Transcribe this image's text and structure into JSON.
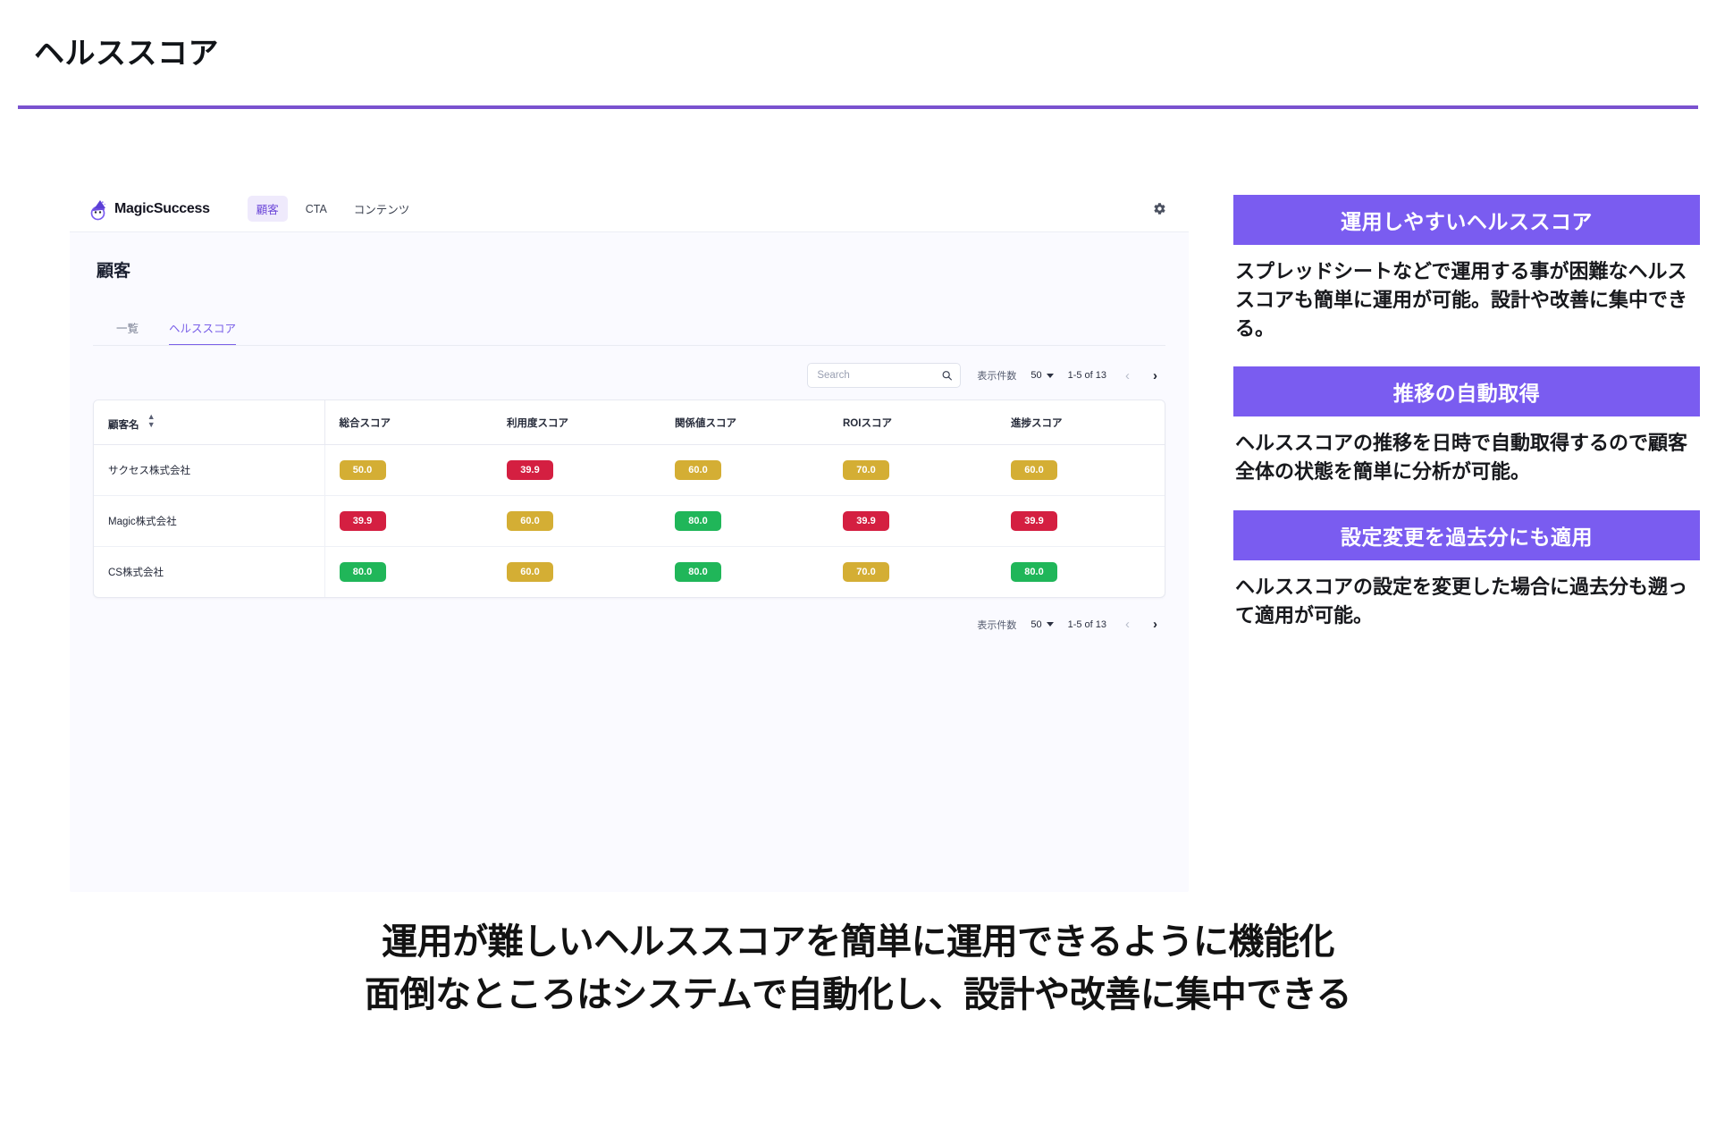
{
  "slide": {
    "title": "ヘルススコア",
    "accent_color": "#7a52cf",
    "caption_line1": "運用が難しいヘルススコアを簡単に運用できるように機能化",
    "caption_line2": "面倒なところはシステムで自動化し、設計や改善に集中できる"
  },
  "app": {
    "logo_text": "MagicSuccess",
    "nav": [
      {
        "label": "顧客",
        "active": true
      },
      {
        "label": "CTA",
        "active": false
      },
      {
        "label": "コンテンツ",
        "active": false
      }
    ],
    "settings_icon": "gear-icon",
    "page_title": "顧客",
    "tabs": [
      {
        "label": "一覧",
        "active": false
      },
      {
        "label": "ヘルススコア",
        "active": true
      }
    ],
    "search": {
      "placeholder": "Search",
      "value": "",
      "icon": "search-icon"
    },
    "pagination": {
      "rows_label": "表示件数",
      "rows_value": "50",
      "range": "1-5 of 13",
      "prev": "‹",
      "next": "›"
    },
    "table": {
      "columns": [
        "顧客名",
        "総合スコア",
        "利用度スコア",
        "関係値スコア",
        "ROIスコア",
        "進捗スコア"
      ],
      "sort_icon": "sort-updown-icon",
      "rows": [
        {
          "name": "サクセス株式会社",
          "scores": [
            {
              "value": "50.0",
              "color": "gold"
            },
            {
              "value": "39.9",
              "color": "red"
            },
            {
              "value": "60.0",
              "color": "gold"
            },
            {
              "value": "70.0",
              "color": "gold"
            },
            {
              "value": "60.0",
              "color": "gold"
            }
          ]
        },
        {
          "name": "Magic株式会社",
          "scores": [
            {
              "value": "39.9",
              "color": "red"
            },
            {
              "value": "60.0",
              "color": "gold"
            },
            {
              "value": "80.0",
              "color": "green"
            },
            {
              "value": "39.9",
              "color": "red"
            },
            {
              "value": "39.9",
              "color": "red"
            }
          ]
        },
        {
          "name": "CS株式会社",
          "scores": [
            {
              "value": "80.0",
              "color": "green"
            },
            {
              "value": "60.0",
              "color": "gold"
            },
            {
              "value": "80.0",
              "color": "green"
            },
            {
              "value": "70.0",
              "color": "gold"
            },
            {
              "value": "80.0",
              "color": "green"
            }
          ]
        }
      ],
      "badge_colors": {
        "gold": "#d4ae34",
        "red": "#d41f41",
        "green": "#20b659"
      }
    }
  },
  "features": [
    {
      "heading": "運用しやすいヘルススコア",
      "body": "スプレッドシートなどで運用する事が困難なヘルススコアも簡単に運用が可能。設計や改善に集中できる。"
    },
    {
      "heading": "推移の自動取得",
      "body": "ヘルススコアの推移を日時で自動取得するので顧客全体の状態を簡単に分析が可能。"
    },
    {
      "heading": "設定変更を過去分にも適用",
      "body": "ヘルススコアの設定を変更した場合に過去分も遡って適用が可能。"
    }
  ]
}
